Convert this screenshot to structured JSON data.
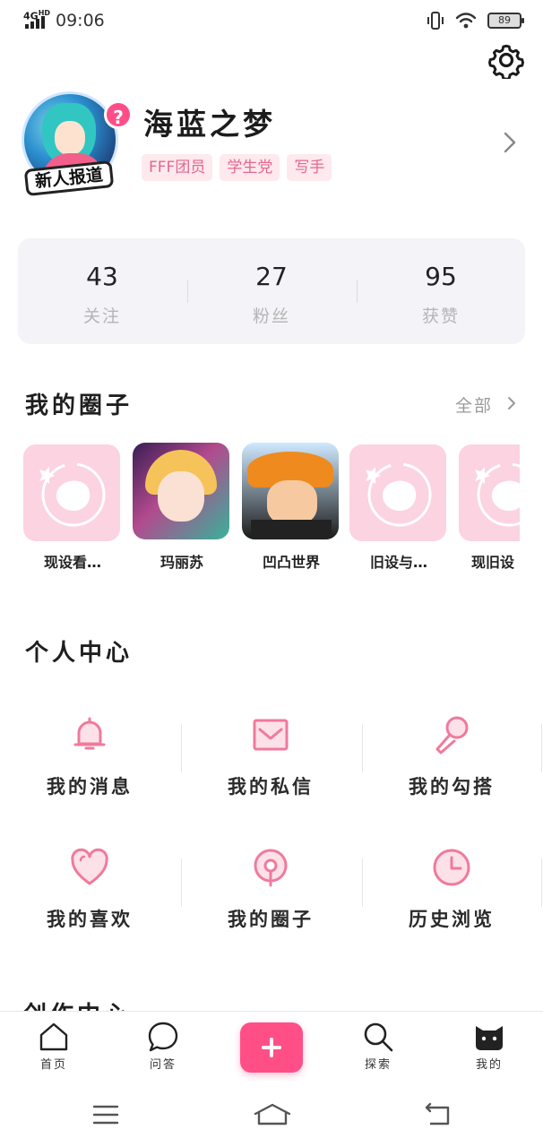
{
  "status_bar": {
    "network": "4G",
    "network_sup": "HD",
    "time": "09:06",
    "battery": "89"
  },
  "profile": {
    "avatar_badge": "新人报道",
    "nickname": "海蓝之梦",
    "tags": [
      "FFF团员",
      "学生党",
      "写手"
    ]
  },
  "stats": [
    {
      "value": "43",
      "label": "关注"
    },
    {
      "value": "27",
      "label": "粉丝"
    },
    {
      "value": "95",
      "label": "获赞"
    }
  ],
  "circles_section": {
    "title": "我的圈子",
    "all_label": "全部",
    "items": [
      {
        "name": "现设看…",
        "art": "placeholder"
      },
      {
        "name": "玛丽苏",
        "art": "anime-girl"
      },
      {
        "name": "凹凸世界",
        "art": "anime-boy"
      },
      {
        "name": "旧设与…",
        "art": "placeholder"
      },
      {
        "name": "现旧设",
        "art": "placeholder"
      }
    ]
  },
  "personal_center": {
    "title": "个人中心",
    "items": [
      {
        "label": "我的消息",
        "icon": "bell-icon"
      },
      {
        "label": "我的私信",
        "icon": "envelope-icon"
      },
      {
        "label": "我的勾搭",
        "icon": "microphone-icon"
      },
      {
        "label": "我的喜欢",
        "icon": "heart-icon"
      },
      {
        "label": "我的圈子",
        "icon": "location-pin-icon"
      },
      {
        "label": "历史浏览",
        "icon": "clock-icon"
      }
    ]
  },
  "next_section": {
    "title": "创作中心"
  },
  "bottom_nav": {
    "items": [
      {
        "label": "首页",
        "icon": "home-icon"
      },
      {
        "label": "问答",
        "icon": "chat-bubble-icon"
      },
      {
        "label": "",
        "icon": "plus-icon"
      },
      {
        "label": "探索",
        "icon": "search-icon"
      },
      {
        "label": "我的",
        "icon": "cat-icon"
      }
    ]
  },
  "colors": {
    "accent": "#ff4f86",
    "icon_pink": "#f07a9c",
    "tag_bg": "#fde9ee",
    "tag_text": "#e4688b",
    "stats_bg": "#f3f3f8"
  }
}
